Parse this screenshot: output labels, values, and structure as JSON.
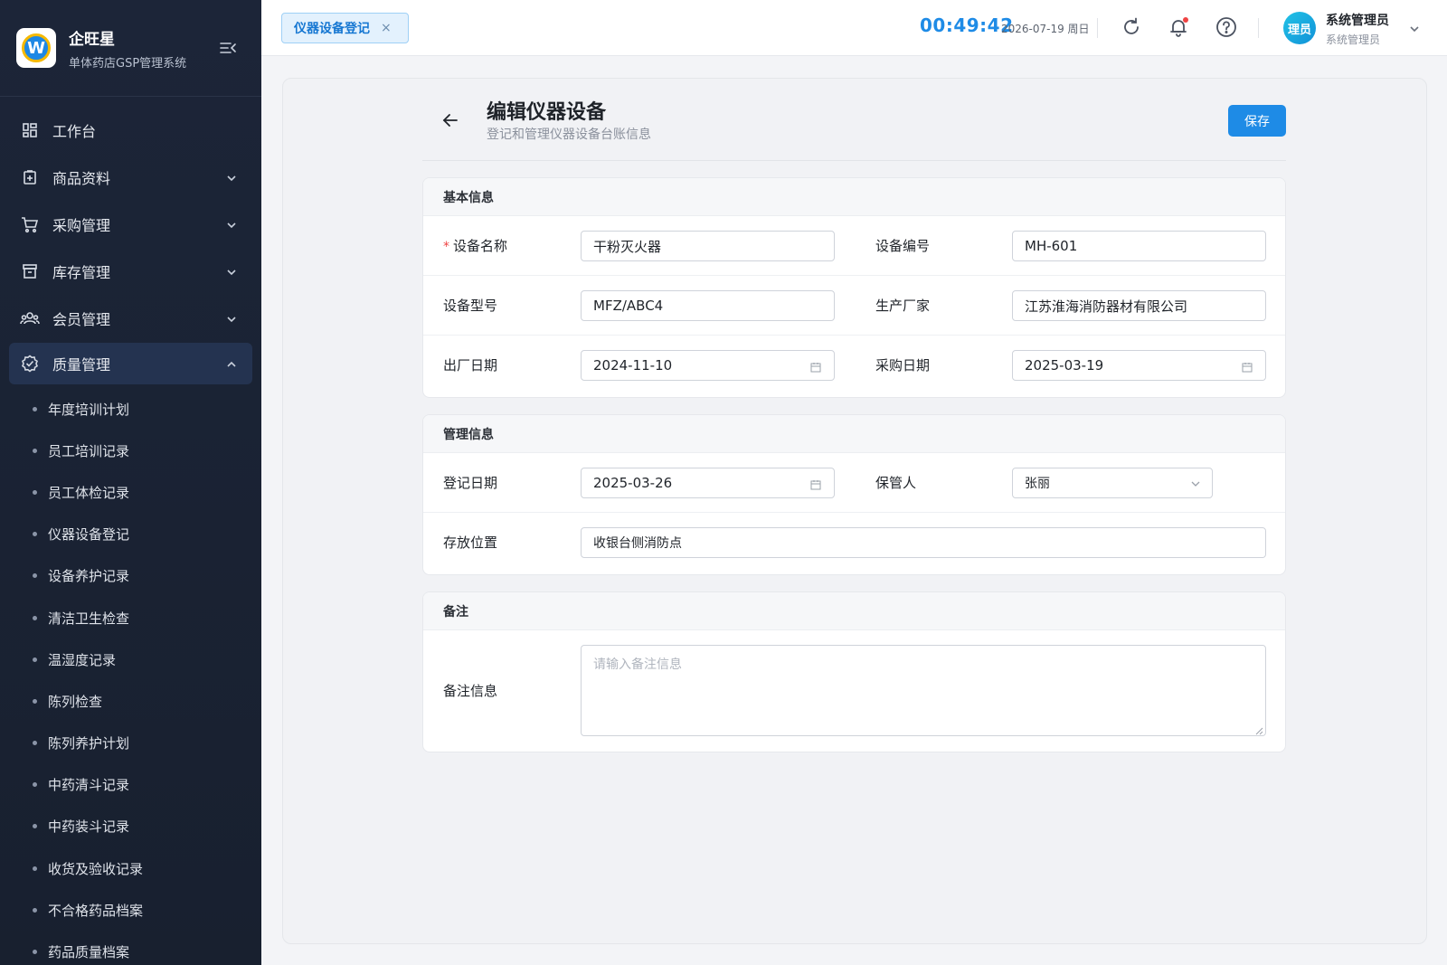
{
  "brand": {
    "name": "企旺星",
    "subtitle": "单体药店GSP管理系统",
    "logo_letter": "W"
  },
  "colors": {
    "primary": "#1e8be6",
    "sidebar_bg": "#1c2538",
    "required": "#ef4444"
  },
  "sidebar": {
    "items": [
      {
        "label": "工作台",
        "icon": "dashboard-icon"
      },
      {
        "label": "商品资料",
        "icon": "product-icon"
      },
      {
        "label": "采购管理",
        "icon": "cart-icon"
      },
      {
        "label": "库存管理",
        "icon": "inventory-icon"
      },
      {
        "label": "会员管理",
        "icon": "members-icon"
      },
      {
        "label": "质量管理",
        "icon": "quality-icon",
        "expanded": true
      }
    ],
    "submenu": [
      "年度培训计划",
      "员工培训记录",
      "员工体检记录",
      "仪器设备登记",
      "设备养护记录",
      "清洁卫生检查",
      "温湿度记录",
      "陈列检查",
      "陈列养护计划",
      "中药清斗记录",
      "中药装斗记录",
      "收货及验收记录",
      "不合格药品档案",
      "药品质量档案"
    ]
  },
  "topbar": {
    "tab_label": "仪器设备登记",
    "tab_close": "×",
    "clock": "00:49:42",
    "date": "2026-07-19 周日",
    "avatar_text": "理员",
    "user_name": "系统管理员",
    "user_role": "系统管理员"
  },
  "page": {
    "title": "编辑仪器设备",
    "subtitle": "登记和管理仪器设备台账信息",
    "save_label": "保存"
  },
  "basic_info": {
    "title": "基本信息",
    "required_mark": "*",
    "name_label": "设备名称",
    "name_value": "干粉灭火器",
    "code_label": "设备编号",
    "code_value": "MH-601",
    "model_label": "设备型号",
    "model_value": "MFZ/ABC4",
    "maker_label": "生产厂家",
    "maker_value": "江苏淮海消防器材有限公司",
    "mfg_date_label": "出厂日期",
    "mfg_date_value": "2024-11-10",
    "purchase_date_label": "采购日期",
    "purchase_date_value": "2025-03-19"
  },
  "management_info": {
    "title": "管理信息",
    "reg_date_label": "登记日期",
    "reg_date_value": "2025-03-26",
    "keeper_label": "保管人",
    "keeper_value": "张丽",
    "location_label": "存放位置",
    "location_value": "收银台侧消防点"
  },
  "remarks": {
    "title": "备注",
    "label": "备注信息",
    "placeholder": "请输入备注信息"
  }
}
